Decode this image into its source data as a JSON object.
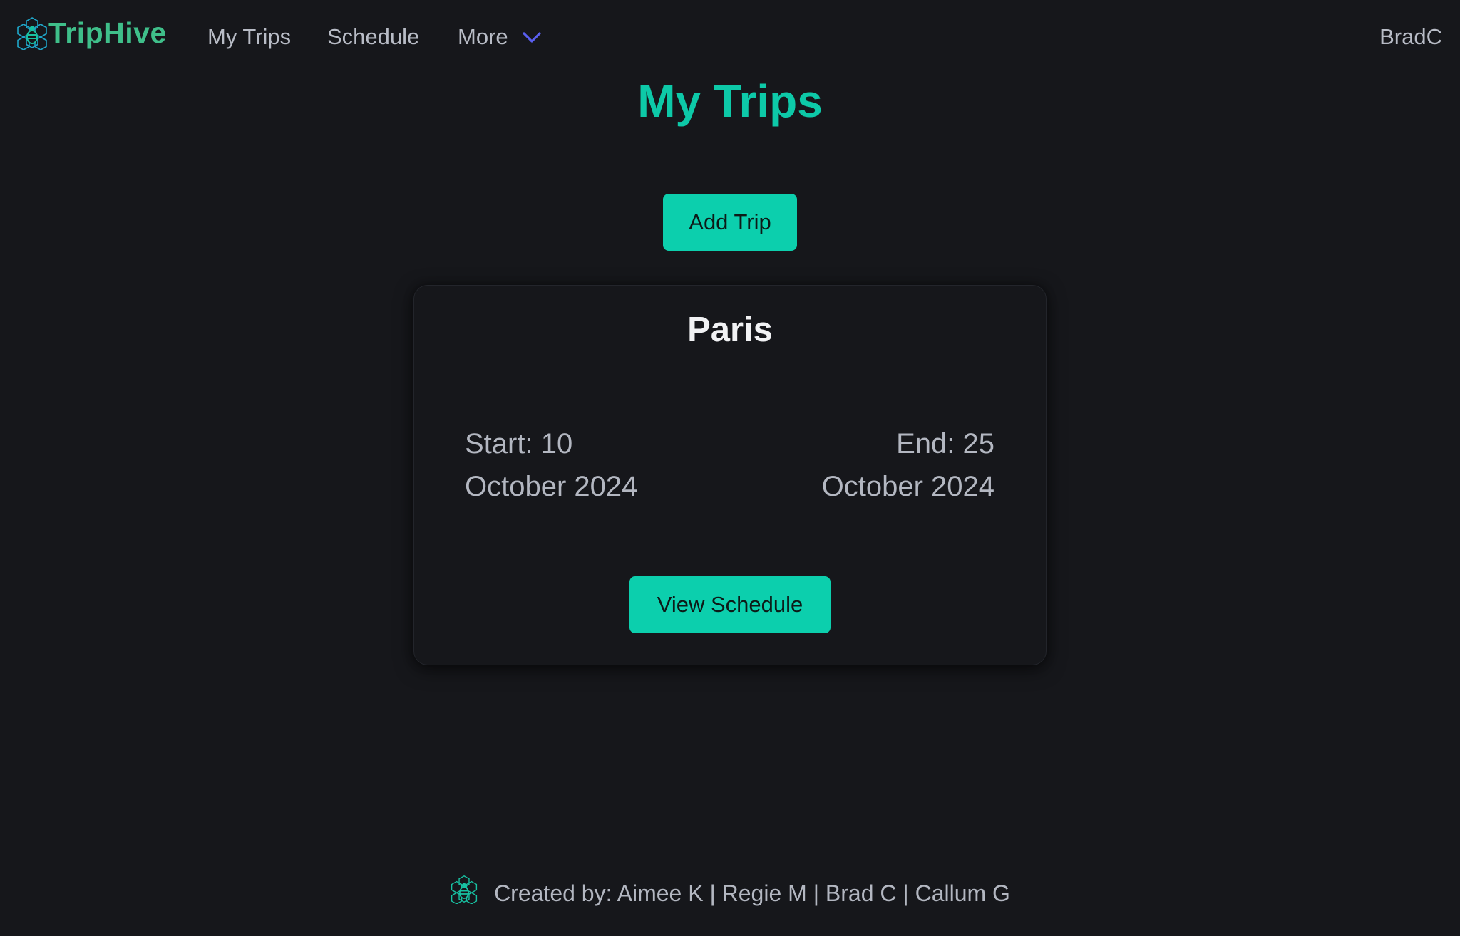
{
  "brand": {
    "name": "TripHive",
    "logo_icon": "bee-hexagon-logo-icon"
  },
  "nav": {
    "my_trips": "My Trips",
    "schedule": "Schedule",
    "more": "More",
    "more_icon": "chevron-down-icon",
    "user": "BradC"
  },
  "page": {
    "title": "My Trips"
  },
  "actions": {
    "add_trip": "Add Trip"
  },
  "trips": [
    {
      "name": "Paris",
      "start_line1": "Start: 10",
      "start_line2": "October 2024",
      "end_line1": "End: 25",
      "end_line2": "October 2024",
      "view_schedule": "View Schedule"
    }
  ],
  "footer": {
    "credits": "Created by: Aimee K | Regie M | Brad C | Callum G"
  },
  "colors": {
    "background": "#16171b",
    "accent": "#0ccfad",
    "brand_text": "#3fbf8a",
    "chevron": "#5a5ff0",
    "muted_text": "#b8bcc6"
  }
}
